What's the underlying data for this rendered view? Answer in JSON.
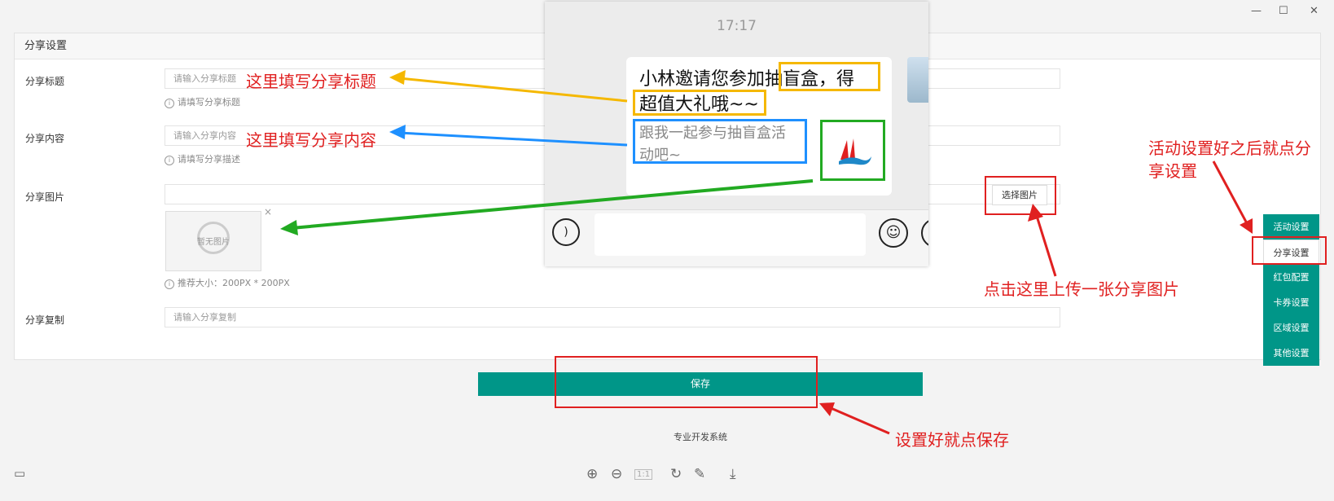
{
  "window": {
    "min_glyph": "—",
    "max_glyph": "☐",
    "close_glyph": "✕"
  },
  "panel": {
    "title": "分享设置"
  },
  "form": {
    "title": {
      "label": "分享标题",
      "placeholder": "请输入分享标题",
      "hint": "请填写分享标题"
    },
    "content": {
      "label": "分享内容",
      "placeholder": "请输入分享内容",
      "hint": "请填写分享描述"
    },
    "image": {
      "label": "分享图片",
      "select_button": "选择图片",
      "placeholder_text": "暂无图片",
      "remove": "×",
      "hint": "推荐大小：200PX * 200PX"
    },
    "copy": {
      "label": "分享复制",
      "placeholder": "请输入分享复制"
    }
  },
  "save_button": "保存",
  "footer": "专业开发系统",
  "sidebar": {
    "items": [
      {
        "label": "活动设置",
        "active": false
      },
      {
        "label": "分享设置",
        "active": true
      },
      {
        "label": "红包配置",
        "active": false
      },
      {
        "label": "卡券设置",
        "active": false
      },
      {
        "label": "区域设置",
        "active": false
      },
      {
        "label": "其他设置",
        "active": false
      }
    ]
  },
  "chat_preview": {
    "time": "17:17",
    "title_line1": "小林邀请您参加抽盲盒，得",
    "title_line2": "超值大礼哦~~",
    "desc_line1": "跟我一起参与抽盲盒活",
    "desc_line2": "动吧~"
  },
  "annotations": {
    "title": "这里填写分享标题",
    "content": "这里填写分享内容",
    "upload": "点击这里上传一张分享图片",
    "sidebar_line1": "活动设置好之后就点分",
    "sidebar_line2": "享设置",
    "save": "设置好就点保存"
  },
  "colors": {
    "primary": "#009688",
    "annotation_red": "#e02020",
    "annotation_yellow": "#f5b800",
    "annotation_blue": "#1e90ff",
    "annotation_green": "#22aa22"
  },
  "toolbar": {
    "icons": [
      "layout-icon",
      "zoom-in-icon",
      "zoom-out-icon",
      "actual-size-icon",
      "rotate-icon",
      "edit-icon",
      "download-icon"
    ],
    "actual_size_label": "1:1"
  }
}
